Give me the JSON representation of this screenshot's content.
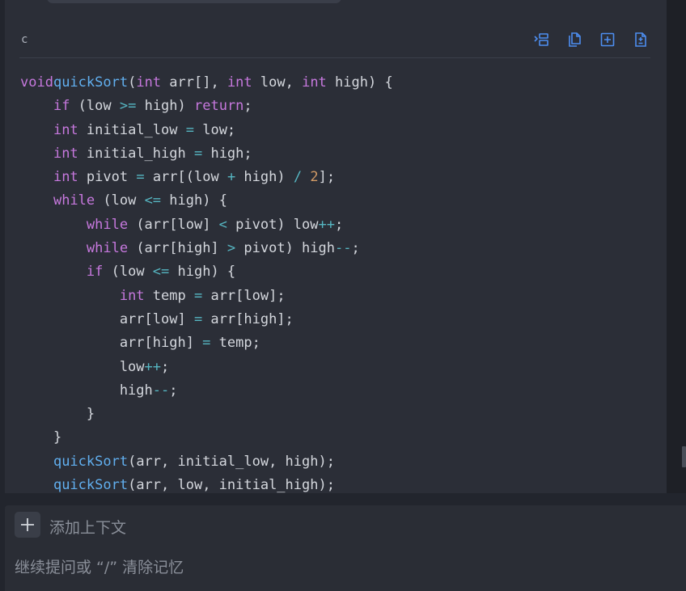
{
  "code_block": {
    "language": "c",
    "toolbar": [
      {
        "name": "insert-at-cursor-icon",
        "title": "insert"
      },
      {
        "name": "copy-icon",
        "title": "copy"
      },
      {
        "name": "new-file-icon",
        "title": "new file"
      },
      {
        "name": "apply-diff-icon",
        "title": "apply"
      }
    ],
    "lines": [
      [
        [
          "kw",
          "void"
        ],
        [
          "",
          ""
        ],
        [
          "fn",
          "quickSort"
        ],
        [
          "",
          "("
        ],
        [
          "kw",
          "int"
        ],
        [
          "",
          " arr[], "
        ],
        [
          "kw",
          "int"
        ],
        [
          "",
          " low, "
        ],
        [
          "kw",
          "int"
        ],
        [
          "",
          " high) {"
        ]
      ],
      [
        [
          "",
          "    "
        ],
        [
          "kw",
          "if"
        ],
        [
          "",
          " (low "
        ],
        [
          "op",
          ">="
        ],
        [
          "",
          " high) "
        ],
        [
          "kw",
          "return"
        ],
        [
          "",
          ";"
        ]
      ],
      [
        [
          "",
          "    "
        ],
        [
          "kw",
          "int"
        ],
        [
          "",
          " initial_low "
        ],
        [
          "op",
          "="
        ],
        [
          "",
          " low;"
        ]
      ],
      [
        [
          "",
          "    "
        ],
        [
          "kw",
          "int"
        ],
        [
          "",
          " initial_high "
        ],
        [
          "op",
          "="
        ],
        [
          "",
          " high;"
        ]
      ],
      [
        [
          "",
          "    "
        ],
        [
          "kw",
          "int"
        ],
        [
          "",
          " pivot "
        ],
        [
          "op",
          "="
        ],
        [
          "",
          " arr[(low "
        ],
        [
          "op",
          "+"
        ],
        [
          "",
          " high) "
        ],
        [
          "op",
          "/"
        ],
        [
          "",
          " "
        ],
        [
          "num",
          "2"
        ],
        [
          "",
          "];"
        ]
      ],
      [
        [
          "",
          "    "
        ],
        [
          "kw",
          "while"
        ],
        [
          "",
          " (low "
        ],
        [
          "op",
          "<="
        ],
        [
          "",
          " high) {"
        ]
      ],
      [
        [
          "",
          "        "
        ],
        [
          "kw",
          "while"
        ],
        [
          "",
          " (arr[low] "
        ],
        [
          "op",
          "<"
        ],
        [
          "",
          " pivot) low"
        ],
        [
          "op",
          "++"
        ],
        [
          "",
          ";"
        ]
      ],
      [
        [
          "",
          "        "
        ],
        [
          "kw",
          "while"
        ],
        [
          "",
          " (arr[high] "
        ],
        [
          "op",
          ">"
        ],
        [
          "",
          " pivot) high"
        ],
        [
          "op",
          "--"
        ],
        [
          "",
          ";"
        ]
      ],
      [
        [
          "",
          "        "
        ],
        [
          "kw",
          "if"
        ],
        [
          "",
          " (low "
        ],
        [
          "op",
          "<="
        ],
        [
          "",
          " high) {"
        ]
      ],
      [
        [
          "",
          "            "
        ],
        [
          "kw",
          "int"
        ],
        [
          "",
          " temp "
        ],
        [
          "op",
          "="
        ],
        [
          "",
          " arr[low];"
        ]
      ],
      [
        [
          "",
          "            arr[low] "
        ],
        [
          "op",
          "="
        ],
        [
          "",
          " arr[high];"
        ]
      ],
      [
        [
          "",
          "            arr[high] "
        ],
        [
          "op",
          "="
        ],
        [
          "",
          " temp;"
        ]
      ],
      [
        [
          "",
          "            low"
        ],
        [
          "op",
          "++"
        ],
        [
          "",
          ";"
        ]
      ],
      [
        [
          "",
          "            high"
        ],
        [
          "op",
          "--"
        ],
        [
          "",
          ";"
        ]
      ],
      [
        [
          "",
          "        }"
        ]
      ],
      [
        [
          "",
          "    }"
        ]
      ],
      [
        [
          "",
          "    "
        ],
        [
          "fn",
          "quickSort"
        ],
        [
          "",
          "(arr, initial_low, high);"
        ]
      ],
      [
        [
          "",
          "    "
        ],
        [
          "fn",
          "quickSort"
        ],
        [
          "",
          "(arr, low, initial_high);"
        ]
      ]
    ]
  },
  "composer": {
    "add_context_label": "添加上下文",
    "input_placeholder": "继续提问或 “/” 清除记忆"
  },
  "colors": {
    "keyword": "#c678dd",
    "function": "#61afef",
    "operator": "#56b6c2",
    "number": "#d19a66",
    "text": "#d4d7dd",
    "icon_accent": "#4d8ef0"
  }
}
